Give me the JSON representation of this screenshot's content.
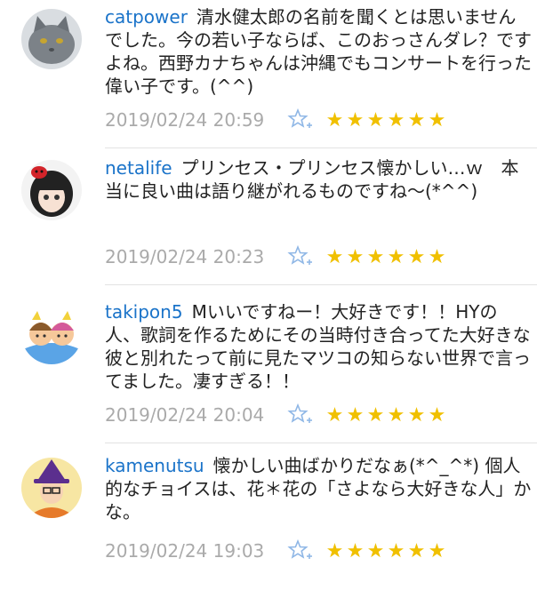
{
  "comments": [
    {
      "username": "catpower",
      "text": "清水健太郎の名前を聞くとは思いませんでした。今の若い子ならば、このおっさんダレ？ですよね。西野カナちゃんは沖縄でもコンサートを行った偉い子です。(^^)",
      "datetime": "2019/02/24 20:59",
      "stars": 6
    },
    {
      "username": "netalife",
      "text": "プリンセス・プリンセス懐かしい…ｗ　本当に良い曲は語り継がれるものですね～(*^^)",
      "datetime": "2019/02/24 20:23",
      "stars": 6
    },
    {
      "username": "takipon5",
      "text": "Mいいですねー！大好きです！！HYの人、歌詞を作るためにその当時付き合ってた大好きな彼と別れたって前に見たマツコの知らない世界で言ってました。凄すぎる！！",
      "datetime": "2019/02/24 20:04",
      "stars": 6
    },
    {
      "username": "kamenutsu",
      "text": "懐かしい曲ばかりだなぁ(*^_^*) 個人的なチョイスは、花＊花の「さよなら大好きな人」かな。",
      "datetime": "2019/02/24 19:03",
      "stars": 6
    }
  ],
  "colors": {
    "username": "#1a73c9",
    "text": "#222222",
    "date": "#aaaaaa",
    "star": "#f0c000",
    "favorite_icon": "#8fb7e6"
  },
  "icons": {
    "favorite": "star-plus-icon",
    "rating": "star-icon"
  }
}
